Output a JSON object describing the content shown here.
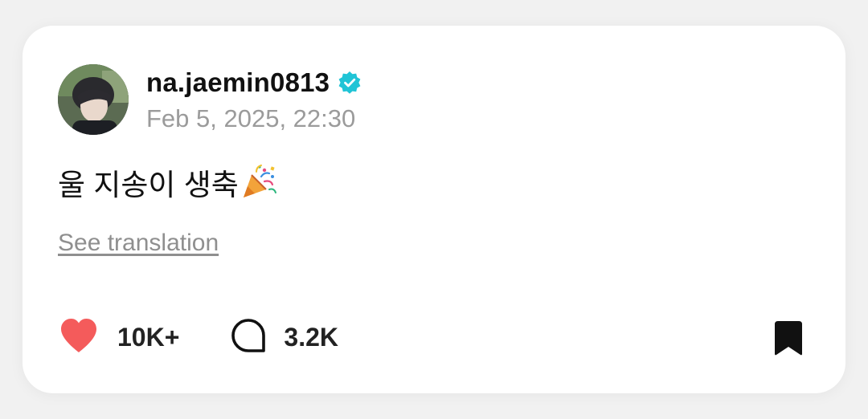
{
  "post": {
    "username": "na.jaemin0813",
    "verified": true,
    "timestamp": "Feb 5, 2025, 22:30",
    "text": "울 지송이 생축",
    "emoji": "party-popper",
    "see_translation": "See translation"
  },
  "actions": {
    "likes": "10K+",
    "comments": "3.2K"
  },
  "colors": {
    "like": "#f45b5b",
    "verified": "#20c4d6",
    "muted": "#9b9b9b"
  },
  "icons": [
    "avatar",
    "verified-badge-icon",
    "party-popper-icon",
    "heart-icon",
    "comment-icon",
    "bookmark-icon"
  ]
}
